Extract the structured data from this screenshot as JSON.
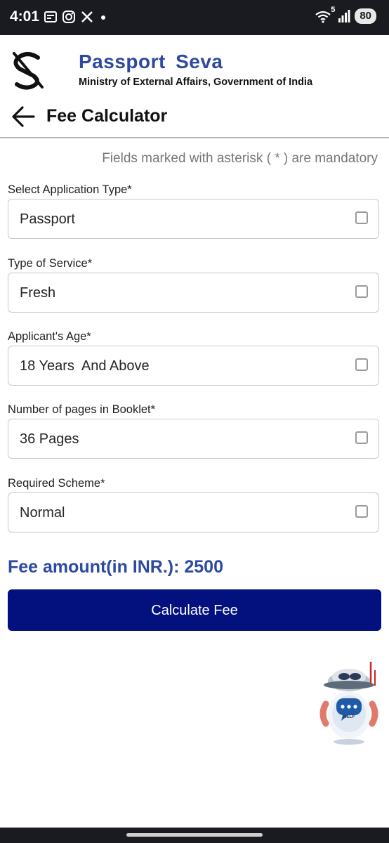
{
  "status_bar": {
    "time": "4:01",
    "network_badge": "5",
    "battery": "80",
    "icons": [
      "calendar-icon",
      "instagram-icon",
      "x-icon",
      "dot-icon",
      "wifi-icon",
      "signal-icon"
    ]
  },
  "header": {
    "brand_title": "Passport  Seva",
    "brand_subtitle": "Ministry of External Affairs, Government of India",
    "page_title": "Fee Calculator",
    "brand_color": "#2d4aa0"
  },
  "form": {
    "mandatory_note": "Fields marked with asterisk ( * ) are mandatory",
    "fields": [
      {
        "label": "Select Application Type*",
        "value": "Passport"
      },
      {
        "label": "Type of Service*",
        "value": "Fresh"
      },
      {
        "label": "Applicant's Age*",
        "value": "18 Years  And Above"
      },
      {
        "label": "Number of pages in Booklet*",
        "value": "36 Pages"
      },
      {
        "label": "Required Scheme*",
        "value": "Normal"
      }
    ]
  },
  "fee": {
    "label": "Fee amount(in INR.): 2500"
  },
  "actions": {
    "calculate_label": "Calculate Fee",
    "button_color": "#03117f"
  },
  "help_bot": {
    "badge": "HELP"
  }
}
